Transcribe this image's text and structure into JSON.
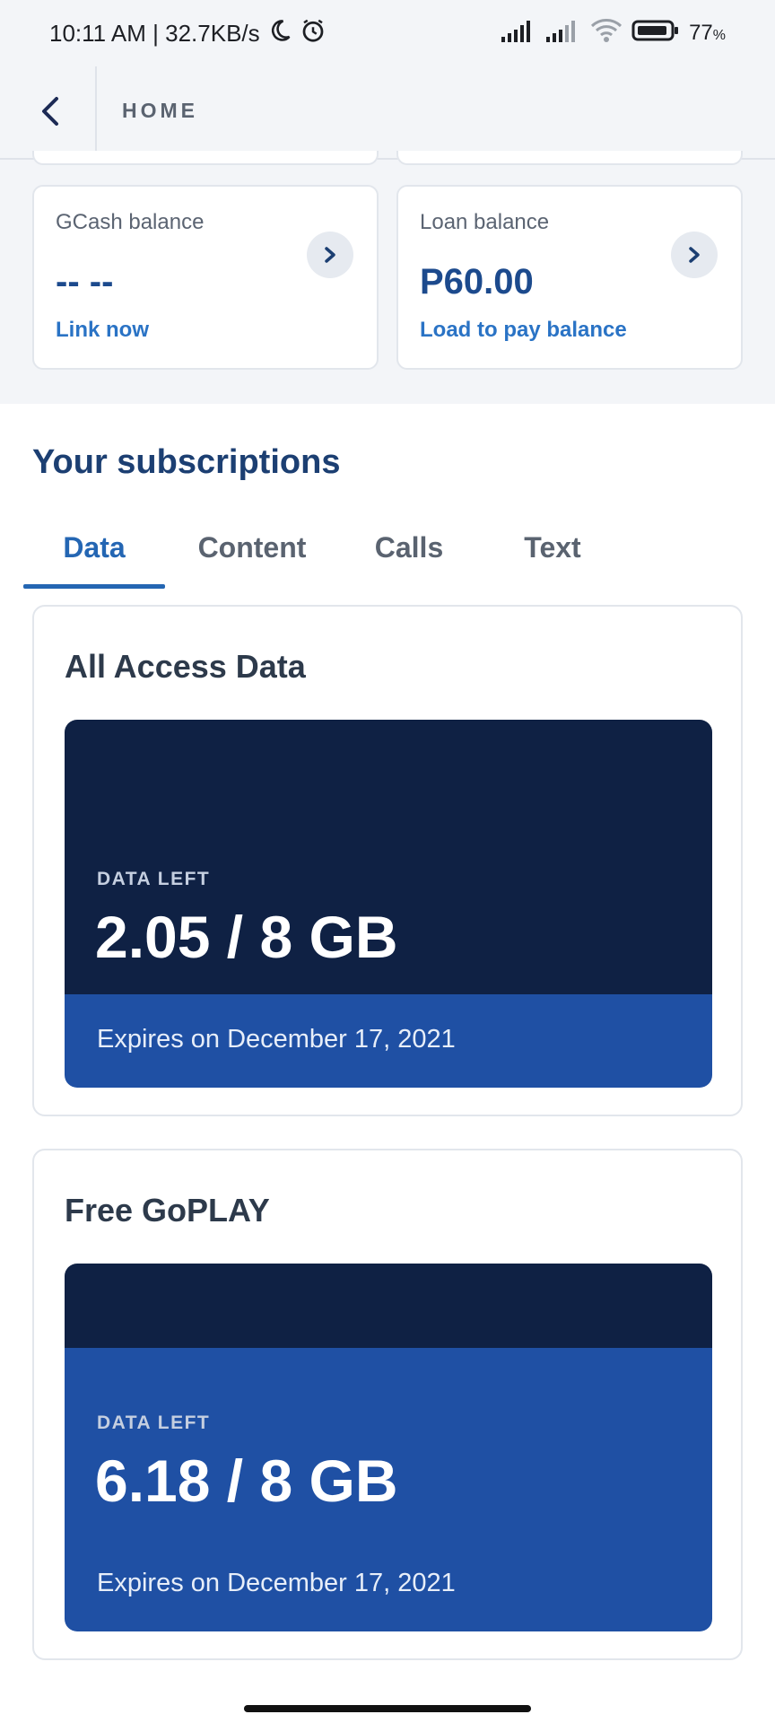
{
  "status_bar": {
    "time_speed": "10:11 AM | 32.7KB/s",
    "battery": "77",
    "battery_unit": "%",
    "icons": [
      "moon-icon",
      "alarm-icon",
      "signal-icon",
      "signal-weak-icon",
      "wifi-icon",
      "battery-icon"
    ]
  },
  "header": {
    "title": "HOME",
    "back_icon": "chevron-left-icon"
  },
  "balances": [
    {
      "label": "GCash balance",
      "value": "-- --",
      "link": "Link now"
    },
    {
      "label": "Loan balance",
      "value": "P60.00",
      "link": "Load to pay balance"
    }
  ],
  "subscriptions": {
    "title": "Your subscriptions",
    "tabs": [
      {
        "label": "Data",
        "active": true
      },
      {
        "label": "Content",
        "active": false
      },
      {
        "label": "Calls",
        "active": false
      },
      {
        "label": "Text",
        "active": false
      }
    ],
    "items": [
      {
        "name": "All Access Data",
        "data_label": "DATA LEFT",
        "amount": "2.05 / 8 GB",
        "expiry": "Expires on December 17, 2021",
        "remaining_gb": 2.05,
        "total_gb": 8
      },
      {
        "name": "Free GoPLAY",
        "data_label": "DATA LEFT",
        "amount": "6.18 / 8 GB",
        "expiry": "Expires on December 17, 2021",
        "remaining_gb": 6.18,
        "total_gb": 8
      }
    ]
  },
  "colors": {
    "navy": "#0f2144",
    "blue": "#1f50a4",
    "link_blue": "#2a73c5",
    "title_blue": "#1c3f72"
  }
}
